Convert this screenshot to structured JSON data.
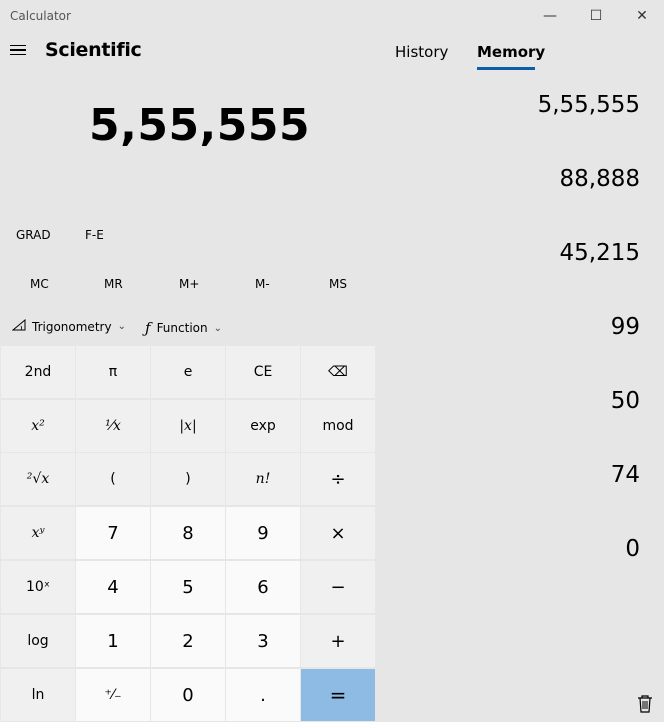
{
  "window": {
    "title": "Calculator",
    "minimize": "—",
    "maximize": "☐",
    "close": "✕"
  },
  "header": {
    "mode": "Scientific",
    "tabs": [
      "History",
      "Memory"
    ],
    "active_tab": "Memory"
  },
  "display": {
    "value": "5,55,555"
  },
  "angle_mode": "GRAD",
  "fe_label": "F-E",
  "memory_buttons": [
    "MC",
    "MR",
    "M+",
    "M-",
    "MS"
  ],
  "toolbar": {
    "trig_label": "Trigonometry",
    "func_label": "Function"
  },
  "memory_items": [
    "5,55,555",
    "88,888",
    "45,215",
    "99",
    "50",
    "74",
    "0"
  ],
  "keys": {
    "row1": [
      "2nd",
      "π",
      "e",
      "CE",
      "⌫"
    ],
    "row2": [
      "x²",
      "¹⁄x",
      "|x|",
      "exp",
      "mod"
    ],
    "row3": [
      "²√x",
      "(",
      ")",
      "n!",
      "÷"
    ],
    "row4": [
      "xʸ",
      "7",
      "8",
      "9",
      "×"
    ],
    "row5": [
      "10ˣ",
      "4",
      "5",
      "6",
      "−"
    ],
    "row6": [
      "log",
      "1",
      "2",
      "3",
      "+"
    ],
    "row7": [
      "ln",
      "⁺⁄₋",
      "0",
      ".",
      "="
    ]
  },
  "colors": {
    "accent": "#0a5fa8",
    "equals": "#8dbbe3",
    "background": "#e6e6e6"
  }
}
